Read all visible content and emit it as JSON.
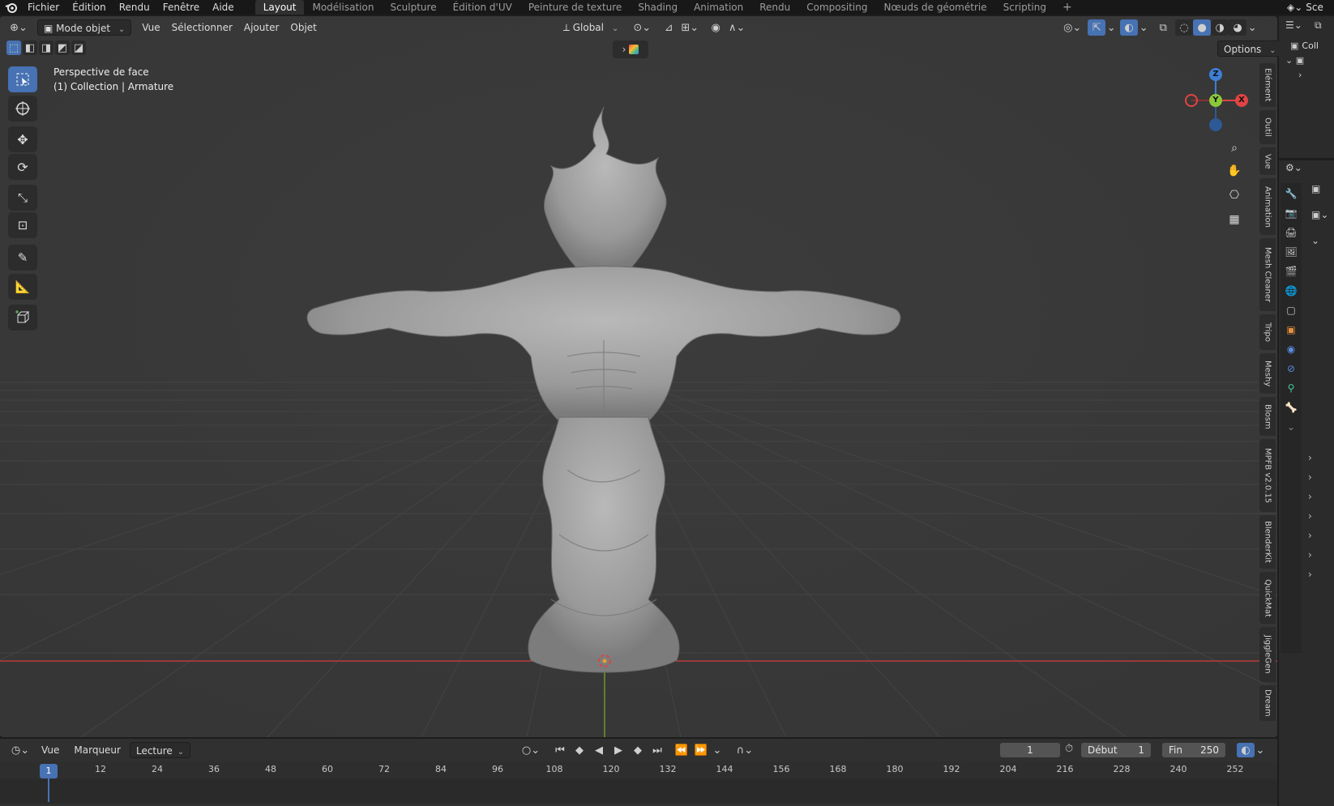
{
  "app": {
    "name": "Blender"
  },
  "menubar": {
    "items": [
      "Fichier",
      "Édition",
      "Rendu",
      "Fenêtre",
      "Aide"
    ],
    "workspaces": [
      "Layout",
      "Modélisation",
      "Sculpture",
      "Édition d'UV",
      "Peinture de texture",
      "Shading",
      "Animation",
      "Rendu",
      "Compositing",
      "Nœuds de géométrie",
      "Scripting"
    ],
    "active_workspace": "Layout",
    "add_tab": "+",
    "scene_label": "Sce"
  },
  "viewport_header": {
    "mode": "Mode objet",
    "menus": [
      "Vue",
      "Sélectionner",
      "Ajouter",
      "Objet"
    ],
    "orientation": "Global",
    "options": "Options"
  },
  "viewport": {
    "view_name": "Perspective de face",
    "collection_line": "(1) Collection | Armature",
    "gizmo": {
      "z": "Z",
      "y": "Y",
      "x": "X"
    }
  },
  "side_tabs": [
    "Elément",
    "Outil",
    "Vue",
    "Animation",
    "Mesh Cleaner",
    "Tripo",
    "Meshy",
    "Blosm",
    "MPFB v2.0.15",
    "BlenderKit",
    "QuickMat",
    "JiggleGen",
    "Dream"
  ],
  "timeline": {
    "menus": [
      "Vue",
      "Marqueur"
    ],
    "playback": "Lecture",
    "current_frame": "1",
    "start_label": "Début",
    "start_value": "1",
    "end_label": "Fin",
    "end_value": "250",
    "ruler_marker": "1",
    "ruler": [
      "12",
      "24",
      "36",
      "48",
      "60",
      "72",
      "84",
      "96",
      "108",
      "120",
      "132",
      "144",
      "156",
      "168",
      "180",
      "192",
      "204",
      "216",
      "228",
      "240",
      "252"
    ]
  },
  "outliner": {
    "collection_label": "Coll"
  },
  "colors": {
    "accent": "#4772b3",
    "x_axis": "#e04444",
    "y_axis": "#8bc83a",
    "z_axis": "#3d7fd6",
    "viewport_bg": "#393939"
  }
}
